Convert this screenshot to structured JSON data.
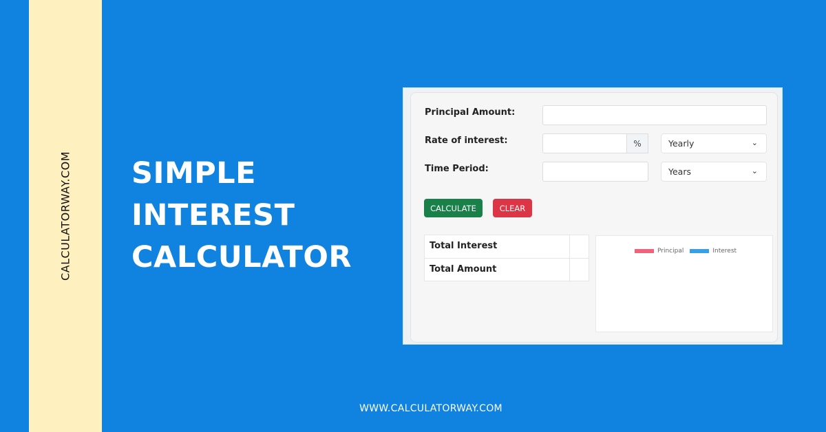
{
  "branding": {
    "vertical_site": "CALCULATORWAY.COM",
    "headline_lines": [
      "SIMPLE",
      "INTEREST",
      "CALCULATOR"
    ],
    "footer_url": "WWW.CALCULATORWAY.COM"
  },
  "colors": {
    "background": "#0f83df",
    "stripe": "#fff1bf",
    "calculate_button": "#1a8049",
    "clear_button": "#dc3545",
    "principal": "#f0637f",
    "interest": "#3aa0e5"
  },
  "form": {
    "principal_label": "Principal Amount:",
    "principal_value": "",
    "rate_label": "Rate of interest:",
    "rate_value": "",
    "rate_addon": "%",
    "rate_period_selected": "Yearly",
    "time_label": "Time Period:",
    "time_value": "",
    "time_unit_selected": "Years",
    "chevron": "⌄"
  },
  "buttons": {
    "calculate": "CALCULATE",
    "clear": "CLEAR"
  },
  "results": [
    {
      "label": "Total Interest",
      "value": ""
    },
    {
      "label": "Total Amount",
      "value": ""
    }
  ],
  "chart_legend": [
    "Principal",
    "Interest"
  ]
}
